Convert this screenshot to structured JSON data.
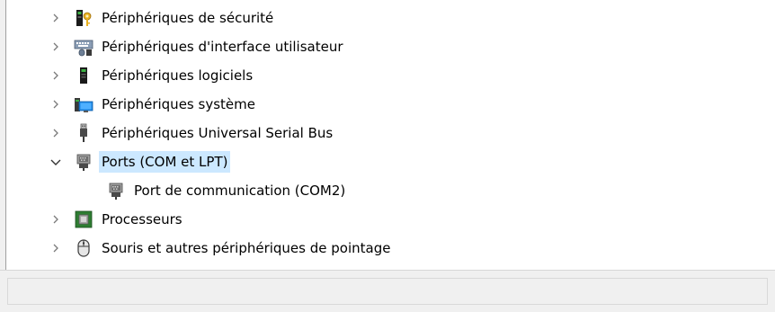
{
  "tree": {
    "items": [
      {
        "label": "Périphériques de sécurité",
        "expander": "collapsed",
        "icon": "security-key-icon"
      },
      {
        "label": "Périphériques d'interface utilisateur",
        "expander": "collapsed",
        "icon": "hid-keyboard-icon"
      },
      {
        "label": "Périphériques logiciels",
        "expander": "collapsed",
        "icon": "software-device-icon"
      },
      {
        "label": "Périphériques système",
        "expander": "collapsed",
        "icon": "system-device-icon"
      },
      {
        "label": "Périphériques Universal Serial Bus",
        "expander": "collapsed",
        "icon": "usb-plug-icon"
      },
      {
        "label": "Ports (COM et LPT)",
        "expander": "expanded",
        "icon": "port-connector-icon",
        "selected": true
      },
      {
        "label": "Port de communication (COM2)",
        "expander": "none",
        "icon": "port-connector-icon",
        "child": true
      },
      {
        "label": "Processeurs",
        "expander": "collapsed",
        "icon": "processor-chip-icon"
      },
      {
        "label": "Souris et autres périphériques de pointage",
        "expander": "collapsed",
        "icon": "mouse-icon"
      }
    ]
  },
  "statusbar": {
    "text": ""
  },
  "colors": {
    "selection": "#cce8ff",
    "chevron": "#7a7a7a"
  }
}
